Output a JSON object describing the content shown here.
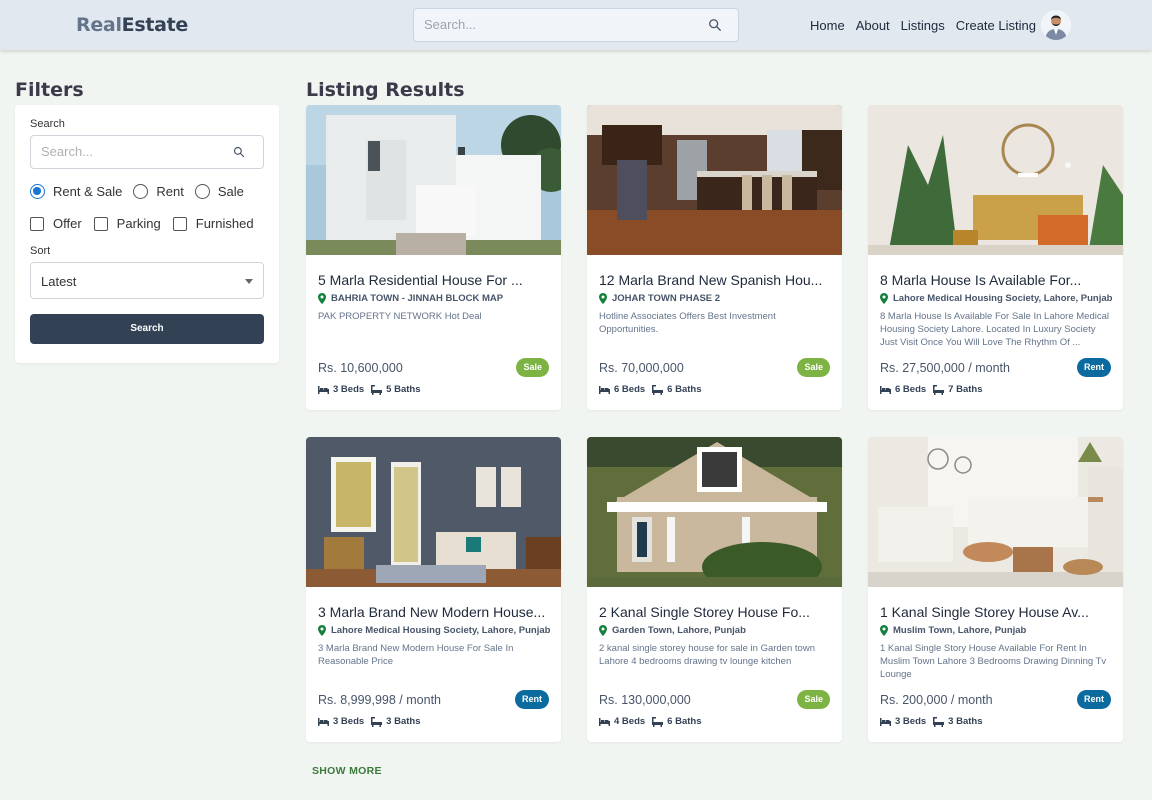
{
  "header": {
    "logo_part1": "Real",
    "logo_part2": "Estate",
    "search_placeholder": "Search...",
    "nav": [
      {
        "label": "Home"
      },
      {
        "label": "About"
      },
      {
        "label": "Listings"
      },
      {
        "label": "Create Listing"
      }
    ],
    "avatar_icon": "user-avatar"
  },
  "filters": {
    "title": "Filters",
    "search_label": "Search",
    "search_placeholder": "Search...",
    "type_options": [
      {
        "label": "Rent & Sale",
        "checked": true
      },
      {
        "label": "Rent",
        "checked": false
      },
      {
        "label": "Sale",
        "checked": false
      }
    ],
    "amenities": [
      {
        "label": "Offer",
        "checked": false
      },
      {
        "label": "Parking",
        "checked": false
      },
      {
        "label": "Furnished",
        "checked": false
      }
    ],
    "sort_label": "Sort",
    "sort_value": "Latest",
    "search_button": "Search"
  },
  "results": {
    "title": "Listing Results",
    "listings": [
      {
        "title": "5 Marla Residential House For ...",
        "location": "BAHRIA TOWN - JINNAH BLOCK MAP",
        "description": "PAK PROPERTY NETWORK Hot Deal",
        "price": "Rs. 10,600,000",
        "badge": "Sale",
        "beds": "3 Beds",
        "baths": "5 Baths"
      },
      {
        "title": "12 Marla Brand New Spanish Hou...",
        "location": "JOHAR TOWN PHASE 2",
        "description": "Hotline Associates Offers Best Investment Opportunities.",
        "price": "Rs. 70,000,000",
        "badge": "Sale",
        "beds": "6 Beds",
        "baths": "6 Baths"
      },
      {
        "title": "8 Marla House Is Available For...",
        "location": "Lahore Medical Housing Society, Lahore, Punjab",
        "description": "8 Marla House Is Available For Sale In Lahore Medical Housing Society Lahore. Located In Luxury Society Just Visit Once You Will Love The Rhythm Of ...",
        "price": "Rs. 27,500,000 / month",
        "badge": "Rent",
        "beds": "6 Beds",
        "baths": "7 Baths"
      },
      {
        "title": "3 Marla Brand New Modern House...",
        "location": "Lahore Medical Housing Society, Lahore, Punjab",
        "description": "3 Marla Brand New Modern House For Sale In Reasonable Price",
        "price": "Rs. 8,999,998 / month",
        "badge": "Rent",
        "beds": "3 Beds",
        "baths": "3 Baths"
      },
      {
        "title": "2 Kanal Single Storey House Fo...",
        "location": "Garden Town, Lahore, Punjab",
        "description": "2 kanal single storey house for sale in Garden town Lahore 4 bedrooms drawing tv lounge kitchen",
        "price": "Rs. 130,000,000",
        "badge": "Sale",
        "beds": "4 Beds",
        "baths": "6 Baths"
      },
      {
        "title": "1 Kanal Single Storey House Av...",
        "location": "Muslim Town, Lahore, Punjab",
        "description": "1 Kanal Single Story House Available For Rent In Muslim Town Lahore 3 Bedrooms Drawing Dinning Tv Lounge",
        "price": "Rs. 200,000 / month",
        "badge": "Rent",
        "beds": "3 Beds",
        "baths": "3 Baths"
      }
    ],
    "show_more": "SHOW MORE"
  },
  "colors": {
    "sale_badge": "#7cb342",
    "rent_badge": "#0b6a9e",
    "primary_button": "#334155",
    "location_pin": "#15803d",
    "radio_accent": "#1976d2"
  }
}
